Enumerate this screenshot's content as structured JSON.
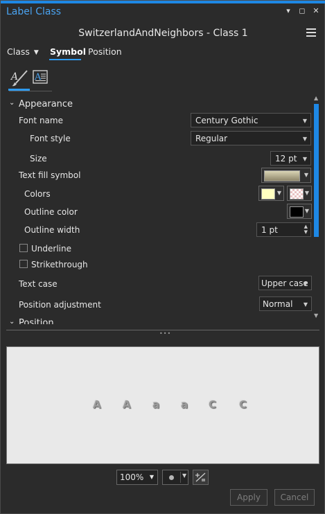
{
  "pane": {
    "title": "Label Class",
    "menu_glyph": "▾",
    "restore_glyph": "◻",
    "close_glyph": "✕"
  },
  "header": {
    "title": "SwitzerlandAndNeighbors - Class 1"
  },
  "tabs": [
    {
      "label": "Class"
    },
    {
      "label": "Symbol"
    },
    {
      "label": "Position"
    }
  ],
  "subtabs": [
    {
      "icon": "text-symbol-brush-icon"
    },
    {
      "icon": "text-formatting-icon"
    }
  ],
  "appearance": {
    "section_label": "Appearance",
    "font_name": {
      "label": "Font name",
      "value": "Century Gothic"
    },
    "font_style": {
      "label": "Font style",
      "value": "Regular"
    },
    "size": {
      "label": "Size",
      "value": "12 pt"
    },
    "text_fill_symbol": {
      "label": "Text fill symbol"
    },
    "colors": {
      "label": "Colors",
      "color1": "#ffffc0",
      "color2": "none"
    },
    "outline_color": {
      "label": "Outline color",
      "value": "#000000"
    },
    "outline_width": {
      "label": "Outline width",
      "value": "1 pt"
    },
    "underline": {
      "label": "Underline",
      "checked": false
    },
    "strikethrough": {
      "label": "Strikethrough",
      "checked": false
    },
    "text_case": {
      "label": "Text case",
      "value": "Upper case"
    },
    "position_adjustment": {
      "label": "Position adjustment",
      "value": "Normal"
    }
  },
  "next_section": {
    "label": "Position"
  },
  "preview": {
    "glyphs": [
      "A",
      "A",
      "a",
      "a",
      "C",
      "C"
    ]
  },
  "bottom": {
    "zoom": "100%"
  },
  "buttons": {
    "apply": "Apply",
    "cancel": "Cancel"
  },
  "colors": {
    "accent": "#1e88e5",
    "background": "#2b2b2b",
    "preview_bg": "#e9e9e9"
  }
}
